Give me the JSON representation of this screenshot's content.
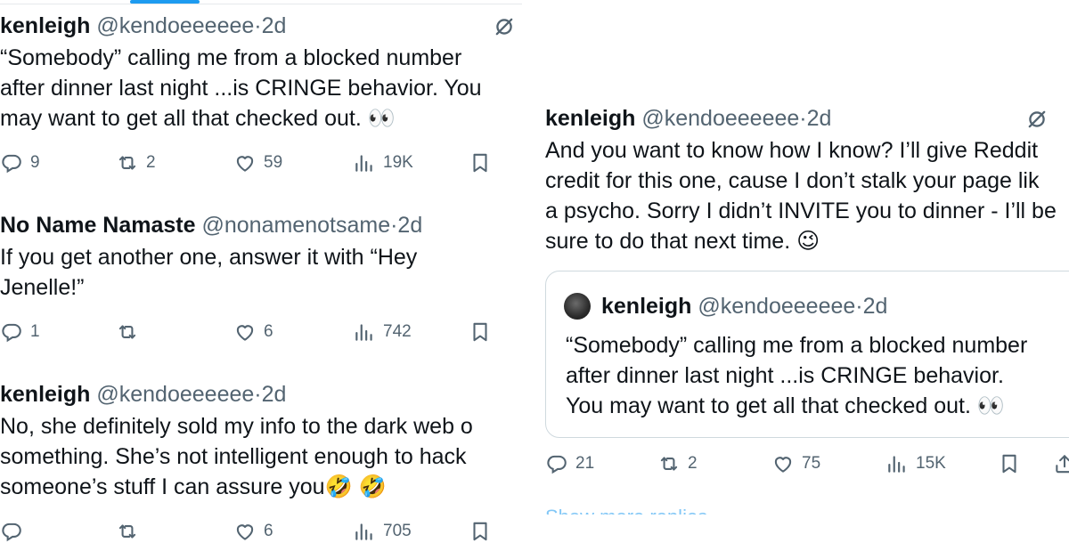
{
  "left": {
    "tweets": [
      {
        "name": "kenleigh",
        "handle": "@kendoeeeeee",
        "sep": "·",
        "time": "2d",
        "lines": [
          "“Somebody” calling me from a blocked number",
          "after dinner last night ...is CRINGE behavior. You",
          "may want to get all that checked out. 👀"
        ],
        "replies": "9",
        "reposts": "2",
        "likes": "59",
        "views": "19K"
      },
      {
        "name": "No Name Namaste",
        "handle": "@nonamenotsame",
        "sep": "·",
        "time": "2d",
        "lines": [
          "If you get another one, answer it with “Hey",
          "Jenelle!”"
        ],
        "replies": "1",
        "reposts": "",
        "likes": "6",
        "views": "742"
      },
      {
        "name": "kenleigh",
        "handle": "@kendoeeeeee",
        "sep": "·",
        "time": "2d",
        "lines": [
          "No, she definitely sold my info to the dark web o",
          "something. She’s not intelligent enough to hack",
          "someone’s stuff I can assure you🤣 🤣"
        ],
        "replies": "",
        "reposts": "",
        "likes": "6",
        "views": "705"
      }
    ]
  },
  "right": {
    "tweet": {
      "name": "kenleigh",
      "handle": "@kendoeeeeee",
      "sep": "·",
      "time": "2d",
      "lines": [
        "And you want to know how I know? I’ll give Reddit",
        "credit for this one, cause I don’t stalk your page lik",
        "a psycho. Sorry I didn’t INVITE you to dinner - I’ll be",
        "sure to do that next time. 😉"
      ],
      "replies": "21",
      "reposts": "2",
      "likes": "75",
      "views": "15K"
    },
    "quote": {
      "name": "kenleigh",
      "handle": "@kendoeeeeee",
      "sep": "·",
      "time": "2d",
      "lines": [
        "“Somebody” calling me from a blocked number",
        "after dinner last night ...is CRINGE behavior.",
        "You may want to get all that checked out. 👀"
      ]
    },
    "show_more": "Show more replies"
  },
  "icons": {
    "reply": "reply-icon",
    "repost": "repost-icon",
    "like": "like-icon",
    "views": "views-icon",
    "bookmark": "bookmark-icon",
    "share": "share-icon",
    "mute": "mute-icon"
  },
  "colors": {
    "accent": "#1d9bf0",
    "muted": "#536471",
    "text": "#0f1419",
    "border": "#cfd9de"
  }
}
